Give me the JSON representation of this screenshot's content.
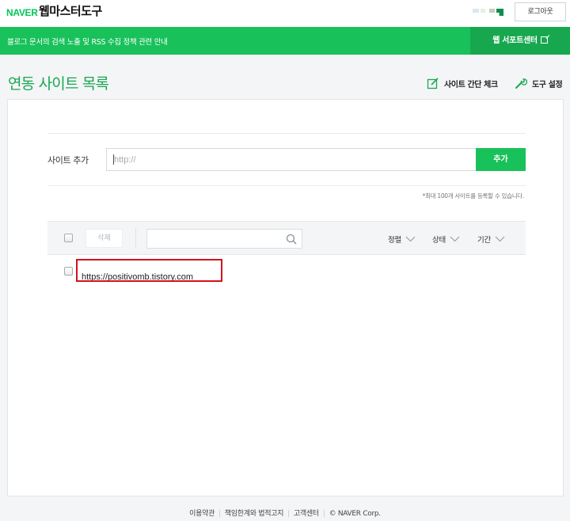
{
  "header": {
    "brand": "NAVER",
    "title": "웹마스터도구",
    "logout_label": "로그아웃"
  },
  "banner": {
    "text": "블로그 문서의 검색 노출 및 RSS 수집 정책 관련 안내",
    "support_label": "웹 서포트센터"
  },
  "page": {
    "title": "연동 사이트 목록",
    "actions": {
      "check_label": "사이트 간단 체크",
      "settings_label": "도구 설정"
    }
  },
  "add_site": {
    "label": "사이트 추가",
    "placeholder": "http://",
    "button_label": "추가",
    "notice": "*최대 100개 사이트를 등록할 수 있습니다."
  },
  "list": {
    "delete_label": "삭제",
    "search_value": "",
    "sorts": {
      "align": "정렬",
      "status": "상태",
      "period": "기간"
    },
    "sites": [
      {
        "url": "https://positivomb.tistory.com",
        "checked": false
      }
    ]
  },
  "footer": {
    "links": [
      "이용약관",
      "책임한계와 법적고지",
      "고객센터"
    ],
    "copyright": "© NAVER Corp."
  },
  "colors": {
    "brand_green": "#19c15a",
    "dark_green": "#17a84f",
    "highlight_red": "#d5101d"
  }
}
